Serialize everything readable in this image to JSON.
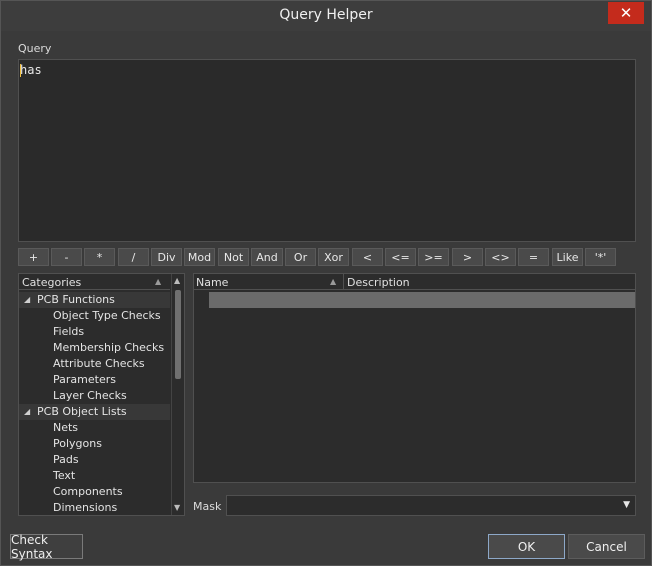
{
  "window": {
    "title": "Query Helper"
  },
  "query": {
    "label": "Query",
    "text": "has"
  },
  "operators": [
    "+",
    "-",
    "*",
    "/",
    "Div",
    "Mod",
    "Not",
    "And",
    "Or",
    "Xor",
    "<",
    "<=",
    ">=",
    ">",
    "<>",
    "=",
    "Like",
    "'*'"
  ],
  "categories": {
    "header": "Categories",
    "groups": [
      {
        "label": "PCB Functions",
        "expanded": true,
        "items": [
          "Object Type Checks",
          "Fields",
          "Membership Checks",
          "Attribute Checks",
          "Parameters",
          "Layer Checks"
        ]
      },
      {
        "label": "PCB Object Lists",
        "expanded": true,
        "items": [
          "Nets",
          "Polygons",
          "Pads",
          "Text",
          "Components",
          "Dimensions"
        ]
      }
    ]
  },
  "results": {
    "columns": [
      "Name",
      "Description"
    ]
  },
  "mask": {
    "label": "Mask",
    "value": ""
  },
  "buttons": {
    "check_syntax": "Check Syntax",
    "ok": "OK",
    "cancel": "Cancel"
  }
}
